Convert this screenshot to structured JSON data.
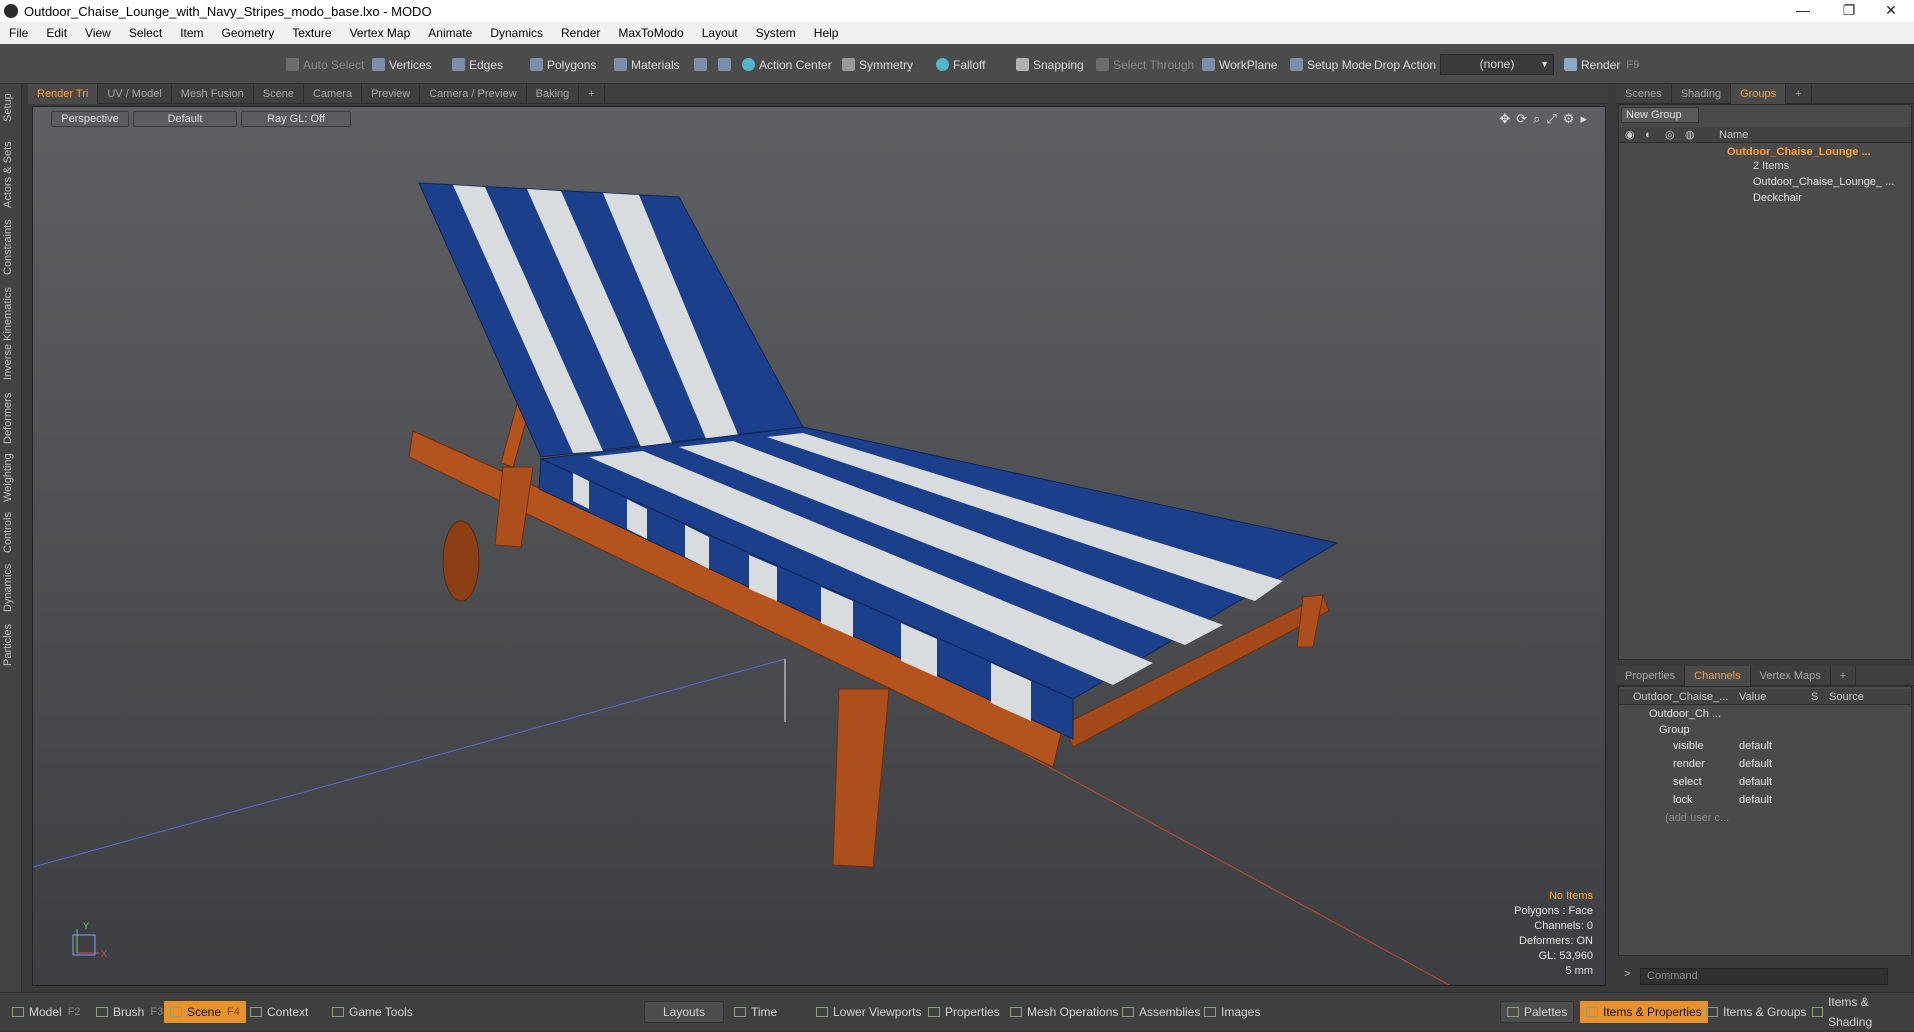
{
  "window": {
    "title": "Outdoor_Chaise_Lounge_with_Navy_Stripes_modo_base.lxo - MODO",
    "controls": [
      "—",
      "❐",
      "✕"
    ]
  },
  "menu": [
    "File",
    "Edit",
    "View",
    "Select",
    "Item",
    "Geometry",
    "Texture",
    "Vertex Map",
    "Animate",
    "Dynamics",
    "Render",
    "MaxToModo",
    "Layout",
    "System",
    "Help"
  ],
  "toolbar": {
    "auto_select": "Auto Select",
    "vertices": "Vertices",
    "edges": "Edges",
    "polygons": "Polygons",
    "materials": "Materials",
    "action_center": "Action Center",
    "symmetry": "Symmetry",
    "falloff": "Falloff",
    "snapping": "Snapping",
    "select_through": "Select Through",
    "workplane": "WorkPlane",
    "setup_mode": "Setup Mode",
    "drop_action": "Drop Action",
    "drop_action_value": "(none)",
    "render": "Render",
    "render_key": "F9"
  },
  "left_tabs": [
    "Setup",
    "Actors & Sets",
    "Constraints",
    "Inverse Kinematics",
    "Deformers",
    "Weighting",
    "Controls",
    "Dynamics",
    "Particles"
  ],
  "viewport_tabs": [
    "Render Tri",
    "UV / Model",
    "Mesh Fusion",
    "Scene",
    "Camera",
    "Preview",
    "Camera / Preview",
    "Baking",
    "+"
  ],
  "viewport": {
    "view": "Perspective",
    "shading": "Default",
    "raygl": "Ray GL: Off",
    "stats": {
      "items": "No Items",
      "polygons": "Polygons : Face",
      "channels": "Channels: 0",
      "deformers": "Deformers: ON",
      "gl": "GL: 53,960",
      "unit": "5 mm"
    }
  },
  "right_top_tabs": [
    "Scenes",
    "Shading",
    "Groups",
    "+"
  ],
  "groups_panel": {
    "new_group": "New Group",
    "name_header": "Name",
    "group_name": "Outdoor_Chaise_Lounge ...",
    "group_count": "2 Items",
    "children": [
      "Outdoor_Chaise_Lounge_ ...",
      "Deckchair"
    ]
  },
  "right_bottom_tabs": [
    "Properties",
    "Channels",
    "Vertex Maps",
    "+"
  ],
  "channels_panel": {
    "headers": [
      "Outdoor_Chaise_...",
      "Value",
      "S",
      "Source"
    ],
    "item": "Outdoor_Ch ...",
    "group": "Group",
    "rows": [
      {
        "name": "visible",
        "value": "default"
      },
      {
        "name": "render",
        "value": "default"
      },
      {
        "name": "select",
        "value": "default"
      },
      {
        "name": "lock",
        "value": "default"
      }
    ],
    "add_user": "(add user c..."
  },
  "command": {
    "prompt": ">",
    "placeholder": "Command"
  },
  "bottom_bar": {
    "left": [
      {
        "label": "Model",
        "key": "F2"
      },
      {
        "label": "Brush",
        "key": "F3"
      },
      {
        "label": "Scene",
        "key": "F4"
      },
      {
        "label": "Context",
        "key": ""
      },
      {
        "label": "Game Tools",
        "key": ""
      }
    ],
    "center": [
      "Layouts",
      "Time",
      "Lower Viewports",
      "Properties",
      "Mesh Operations",
      "Assemblies",
      "Images"
    ],
    "right": [
      "Palettes",
      "Items & Properties",
      "Items & Groups",
      "Items & Shading"
    ]
  },
  "colors": {
    "accent": "#ffa133",
    "navy": "#1c3f8c",
    "cushion_white": "#d9dcdf",
    "wood": "#b5531e"
  }
}
